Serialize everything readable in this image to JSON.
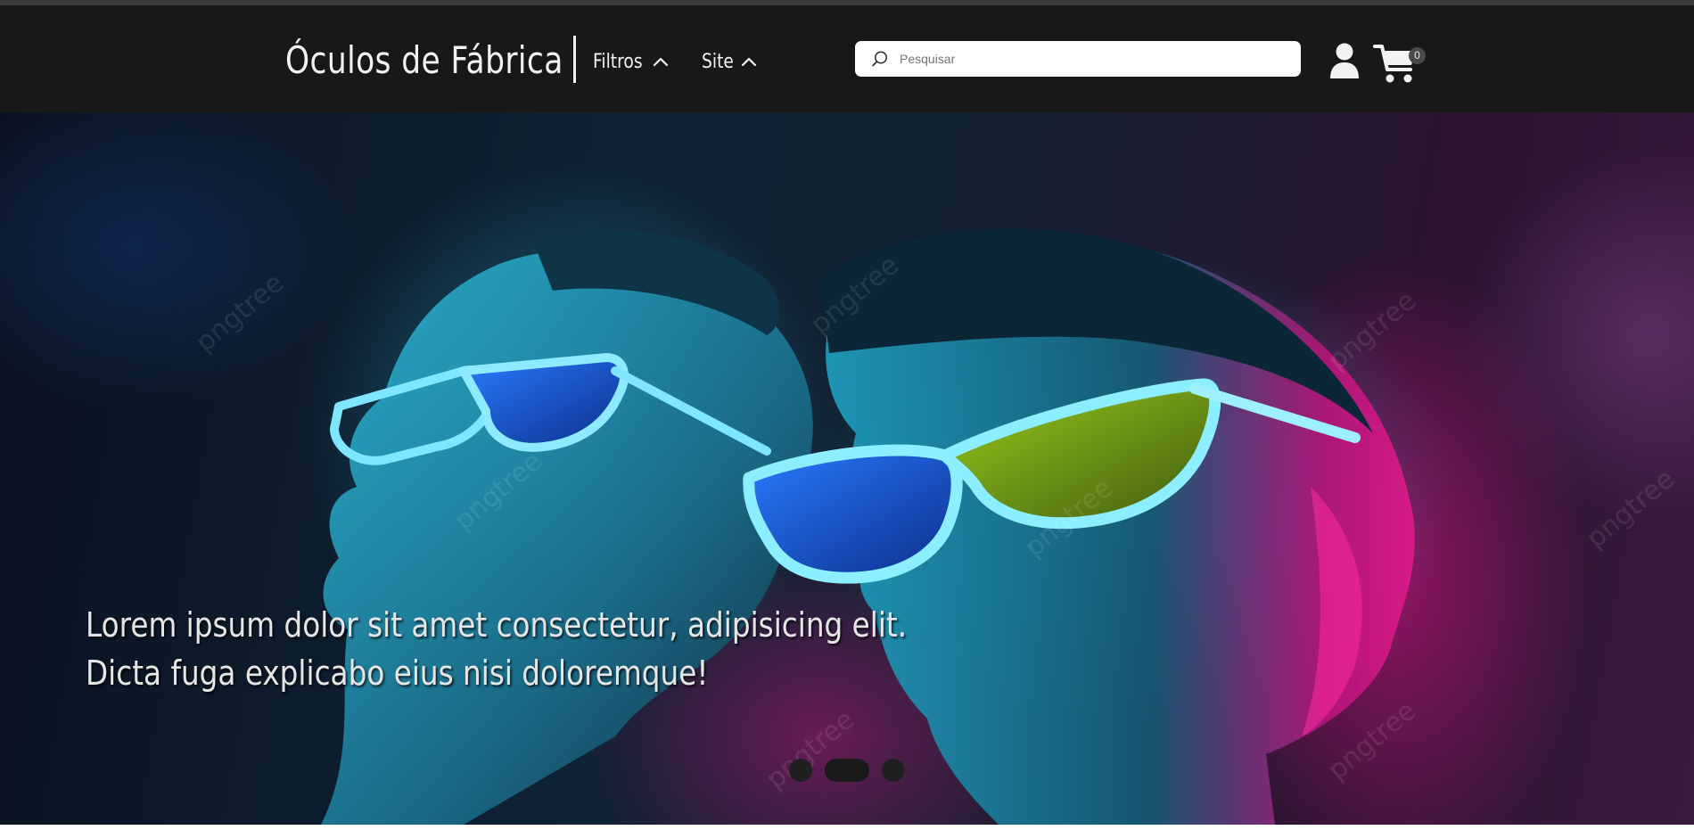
{
  "header": {
    "brand": "Óculos de Fábrica",
    "nav": [
      {
        "label": "Filtros",
        "icon": "chevron-up-icon"
      },
      {
        "label": "Site",
        "icon": "chevron-up-icon"
      }
    ],
    "search": {
      "placeholder": "Pesquisar",
      "value": "",
      "icon": "search-icon"
    },
    "user_icon": "user-icon",
    "cart": {
      "icon": "cart-icon",
      "count": "0"
    }
  },
  "hero": {
    "caption_line1": "Lorem ipsum dolor sit amet consectetur, adipisicing elit.",
    "caption_line2": "Dicta fuga explicabo eius nisi doloremque!",
    "watermark": "pngtree",
    "slides": 3,
    "active_slide": 2
  },
  "colors": {
    "navbar_bg": "#181818",
    "text": "#f2f2f2",
    "neon_cyan": "#22c8e8",
    "neon_pink": "#e8188c"
  }
}
